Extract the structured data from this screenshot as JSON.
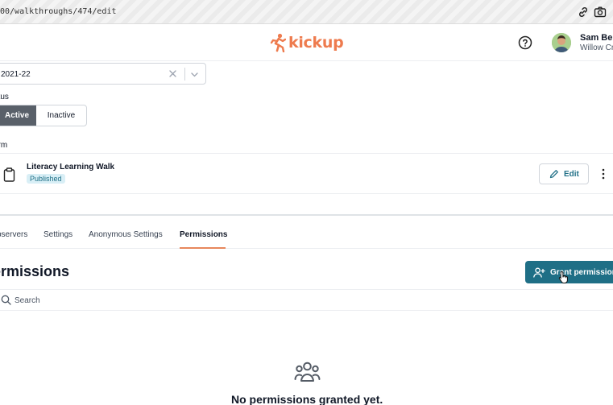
{
  "browser": {
    "url": "00/walkthroughs/474/edit"
  },
  "header": {
    "logo_text": "kickup",
    "user_name": "Sam Ber",
    "user_org": "Willow Cr"
  },
  "filters": {
    "year_value": "2021-22",
    "status_label": "atus",
    "status_options": [
      "Active",
      "Inactive"
    ],
    "status_selected": "Active"
  },
  "form": {
    "section_label": "orm",
    "title": "Literacy Learning Walk",
    "status_badge": "Published",
    "edit_label": "Edit"
  },
  "tabs": [
    {
      "label": "bservers"
    },
    {
      "label": "Settings"
    },
    {
      "label": "Anonymous Settings"
    },
    {
      "label": "Permissions"
    }
  ],
  "permissions": {
    "title": "ermissions",
    "grant_label": "Grant permission",
    "search_placeholder": "Search",
    "empty_text": "No permissions granted yet."
  },
  "colors": {
    "brand_orange": "#ee7b4e",
    "primary_teal": "#1f6f86",
    "badge_bg": "#d9eff6",
    "segment_active": "#596069"
  }
}
